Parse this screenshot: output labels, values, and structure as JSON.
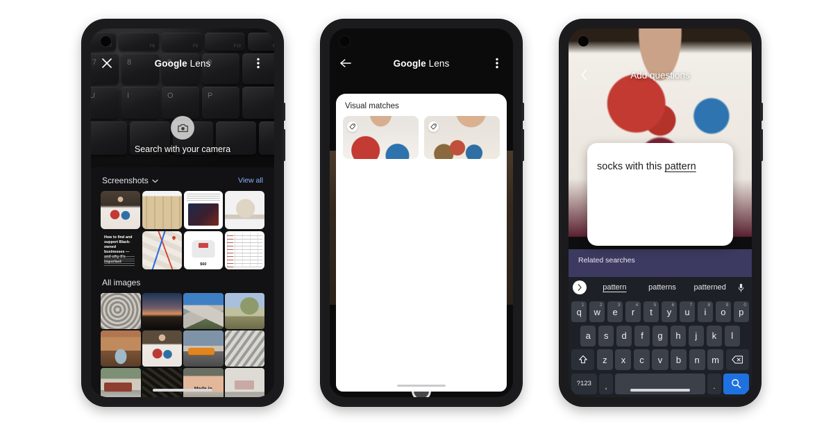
{
  "meta": {
    "background_color": "#ffffff",
    "phone_body_color": "#1b1b1d"
  },
  "phones": [
    {
      "id": "lens-camera-gallery",
      "appbar": {
        "close_icon": "close-icon",
        "title_brand": "Google",
        "title_product": "Lens",
        "overflow_icon": "more-vert-icon"
      },
      "camera": {
        "shutter_icon": "camera-icon",
        "hint": "Search with your camera"
      },
      "gallery": {
        "screenshots": {
          "title": "Screenshots",
          "chevron_icon": "chevron-down-icon",
          "view_all": "View all",
          "items": [
            {
              "name": "floral-shirt-person",
              "alt": "Person in white floral shirt"
            },
            {
              "name": "plaid-coat",
              "alt": "Beige plaid trench coat"
            },
            {
              "name": "lego-product-page",
              "alt": "LEGO Star Wars product listing"
            },
            {
              "name": "beige-cap",
              "alt": "Beige baseball cap"
            },
            {
              "name": "black-owned-article",
              "headline": "How to find and support Black-owned businesses — and why it's important"
            },
            {
              "name": "map-directions",
              "alt": "Map with route and pin"
            },
            {
              "name": "tshirt-listing",
              "price": "$60"
            },
            {
              "name": "spreadsheet-table",
              "alt": "Financial table screenshot"
            }
          ]
        },
        "all_images": {
          "title": "All images",
          "items": [
            {
              "name": "spiral-staircase"
            },
            {
              "name": "sunset-mountains"
            },
            {
              "name": "snowy-peaks"
            },
            {
              "name": "dry-tree-hills"
            },
            {
              "name": "archway-courtyard"
            },
            {
              "name": "floral-shirt-portrait"
            },
            {
              "name": "orange-streetcar"
            },
            {
              "name": "rock-mural"
            },
            {
              "name": "cable-car-street"
            },
            {
              "name": "night-machinery"
            },
            {
              "name": "made-in-building",
              "sign_text": "Made in"
            },
            {
              "name": "white-storefront"
            }
          ]
        }
      }
    },
    {
      "id": "lens-result-visual-matches",
      "appbar": {
        "back_icon": "arrow-back-icon",
        "title_brand": "Google",
        "title_product": "Lens",
        "overflow_icon": "more-vert-icon"
      },
      "viewfinder": {
        "selection_frame": "object-selection-frame",
        "subject": "Person wearing white floral shirt"
      },
      "sheet": {
        "title": "Visual matches",
        "cards": [
          {
            "name": "match-card-1",
            "badge_icon": "price-tag-icon"
          },
          {
            "name": "match-card-2",
            "badge_icon": "price-tag-icon"
          }
        ]
      },
      "shutter_icon": "shutter-button"
    },
    {
      "id": "add-questions-keyboard",
      "appbar": {
        "back_icon": "chevron-back-icon",
        "title": "Add questions"
      },
      "question_field": {
        "text_prefix": "socks with this ",
        "text_highlight": "pattern"
      },
      "related": {
        "label": "Related searches"
      },
      "suggestions": {
        "expand_icon": "chevron-right-icon",
        "items": [
          "pattern",
          "patterns",
          "patterned"
        ],
        "selected_index": 0,
        "mic_icon": "mic-icon"
      },
      "keyboard": {
        "row1": [
          {
            "k": "q",
            "n": "1"
          },
          {
            "k": "w",
            "n": "2"
          },
          {
            "k": "e",
            "n": "3"
          },
          {
            "k": "r",
            "n": "4"
          },
          {
            "k": "t",
            "n": "5"
          },
          {
            "k": "y",
            "n": "6"
          },
          {
            "k": "u",
            "n": "7"
          },
          {
            "k": "i",
            "n": "8"
          },
          {
            "k": "o",
            "n": "9"
          },
          {
            "k": "p",
            "n": "0"
          }
        ],
        "row2": [
          "a",
          "s",
          "d",
          "f",
          "g",
          "h",
          "j",
          "k",
          "l"
        ],
        "row3_shift_icon": "shift-icon",
        "row3": [
          "z",
          "x",
          "c",
          "v",
          "b",
          "n",
          "m"
        ],
        "row3_backspace_icon": "backspace-icon",
        "row4": {
          "symbols_label": "?123",
          "comma": ",",
          "space_label": "",
          "period": ".",
          "search_icon": "search-icon",
          "search_key_color": "#1f71e0"
        }
      }
    }
  ]
}
